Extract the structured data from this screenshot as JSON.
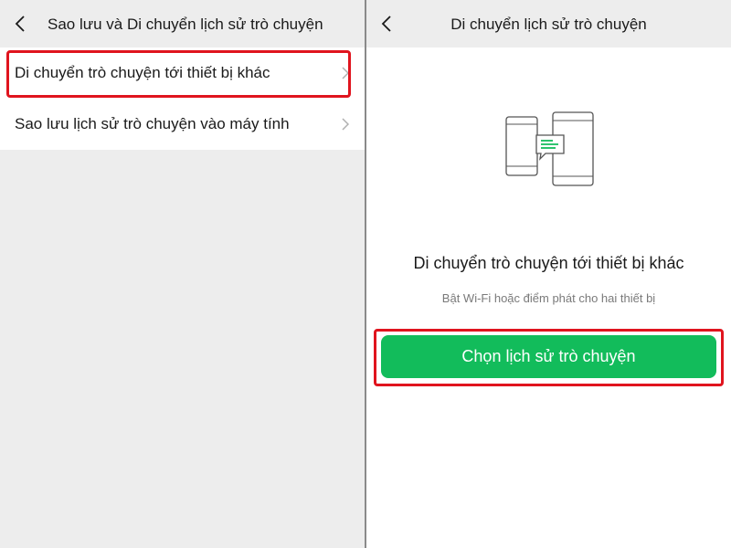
{
  "left_screen": {
    "title": "Sao lưu và Di chuyển lịch sử trò chuyện",
    "back_icon": "chevron-left-icon",
    "items": [
      {
        "label": "Di chuyển trò chuyện tới thiết bị khác",
        "highlighted": true
      },
      {
        "label": "Sao lưu lịch sử trò chuyện vào máy tính",
        "highlighted": false
      }
    ]
  },
  "right_screen": {
    "title": "Di chuyển lịch sử trò chuyện",
    "back_icon": "chevron-left-icon",
    "illustration_icon": "two-phones-transfer-icon",
    "heading": "Di chuyển trò chuyện tới thiết bị khác",
    "subtext": "Bật Wi-Fi hoặc điểm phát cho hai thiết bị",
    "primary_button": "Chọn lịch sử trò chuyện"
  },
  "colors": {
    "background_gray": "#ededed",
    "accent_green": "#12bc5b",
    "highlight_red": "#e0141e",
    "divider": "#8a8a8a"
  }
}
